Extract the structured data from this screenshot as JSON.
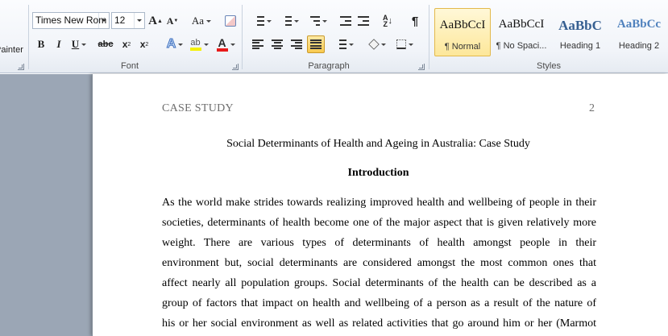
{
  "clipboard": {
    "format_painter_label": "Painter"
  },
  "font": {
    "name": "Times New Rom",
    "size": "12",
    "grow_label": "A",
    "shrink_label": "A",
    "change_case_label": "Aa",
    "bold": "B",
    "italic": "I",
    "underline": "U",
    "strikethrough": "abc",
    "subscript": "x",
    "subscript_mark": "2",
    "superscript": "x",
    "superscript_mark": "2",
    "text_effects": "A",
    "font_color": "A",
    "highlight_color_hex": "#f5f000",
    "font_color_hex": "#e81a1a",
    "group_label": "Font"
  },
  "paragraph": {
    "group_label": "Paragraph",
    "show_marks": "¶",
    "active_alignment": "justify"
  },
  "styles": {
    "group_label": "Styles",
    "items": [
      {
        "sample": "AaBbCcI",
        "name": "¶ Normal",
        "active": true
      },
      {
        "sample": "AaBbCcI",
        "name": "¶ No Spaci...",
        "active": false
      },
      {
        "sample": "AaBbC",
        "name": "Heading 1",
        "active": false
      },
      {
        "sample": "AaBbCc",
        "name": "Heading 2",
        "active": false
      }
    ],
    "heading_color_hex": "#365f91"
  },
  "document": {
    "running_head": "CASE STUDY",
    "page_number": "2",
    "title": "Social Determinants of Health and Ageing in Australia: Case Study",
    "heading": "Introduction",
    "lines": [
      "As the world make strides towards realizing improved health and wellbeing of people in their",
      "societies, determinants of health become one of the major aspect that is given relatively more",
      "weight. There are various types of determinants of health amongst people in their",
      "environment but, social determinants are considered amongst the most common ones that",
      "affect nearly all population groups. Social determinants of the health can be described as a",
      "group of factors that impact on health and wellbeing of a person as a result of the nature of",
      "his or her social environment as well as related activities that go around him or her (Marmot"
    ]
  }
}
